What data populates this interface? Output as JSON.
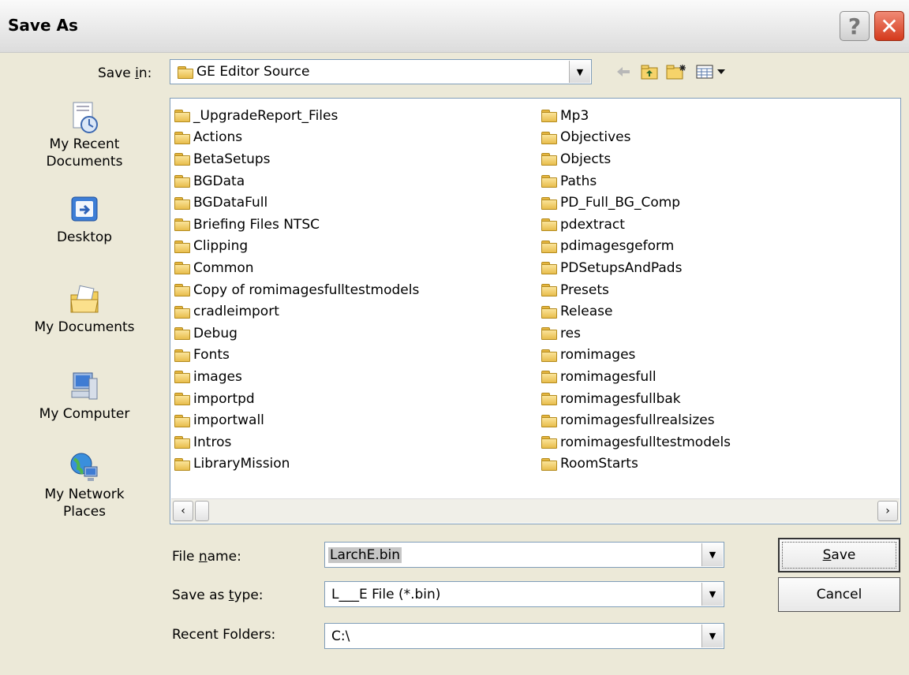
{
  "window": {
    "title": "Save As",
    "help_glyph": "?",
    "close_glyph": "✕"
  },
  "save_in": {
    "label_pre": "Save ",
    "label_ul": "i",
    "label_post": "n:",
    "value": "GE Editor Source"
  },
  "toolbar": {
    "back_icon": "back-arrow-icon",
    "up_icon": "up-folder-icon",
    "new_icon": "new-folder-icon",
    "views_icon": "views-menu-icon"
  },
  "places": [
    {
      "label": "My Recent Documents",
      "line1": "My Recent",
      "line2": "Documents",
      "icon": "recent-documents-icon"
    },
    {
      "label": "Desktop",
      "line1": "Desktop",
      "line2": "",
      "icon": "desktop-icon"
    },
    {
      "label": "My Documents",
      "line1": "My Documents",
      "line2": "",
      "icon": "my-documents-icon"
    },
    {
      "label": "My Computer",
      "line1": "My Computer",
      "line2": "",
      "icon": "my-computer-icon"
    },
    {
      "label": "My Network Places",
      "line1": "My Network",
      "line2": "Places",
      "icon": "network-places-icon"
    }
  ],
  "files_left": [
    "_UpgradeReport_Files",
    "Actions",
    "BetaSetups",
    "BGData",
    "BGDataFull",
    "Briefing Files NTSC",
    "Clipping",
    "Common",
    "Copy of romimagesfulltestmodels",
    "cradleimport",
    "Debug",
    "Fonts",
    "images",
    "importpd",
    "importwall",
    "Intros",
    "LibraryMission"
  ],
  "files_right": [
    "Mp3",
    "Objectives",
    "Objects",
    "Paths",
    "PD_Full_BG_Comp",
    "pdextract",
    "pdimagesgeform",
    "PDSetupsAndPads",
    "Presets",
    "Release",
    "res",
    "romimages",
    "romimagesfull",
    "romimagesfullbak",
    "romimagesfullrealsizes",
    "romimagesfulltestmodels",
    "RoomStarts"
  ],
  "file_name": {
    "label_pre": "File ",
    "label_ul": "n",
    "label_post": "ame:",
    "value": "LarchE.bin"
  },
  "save_as_type": {
    "label_pre": "Save as ",
    "label_ul": "t",
    "label_post": "ype:",
    "value": "L___E File (*.bin)"
  },
  "recent_folders": {
    "label": "Recent Folders:",
    "value": "C:\\"
  },
  "buttons": {
    "save_ul": "S",
    "save_rest": "ave",
    "cancel": "Cancel"
  }
}
